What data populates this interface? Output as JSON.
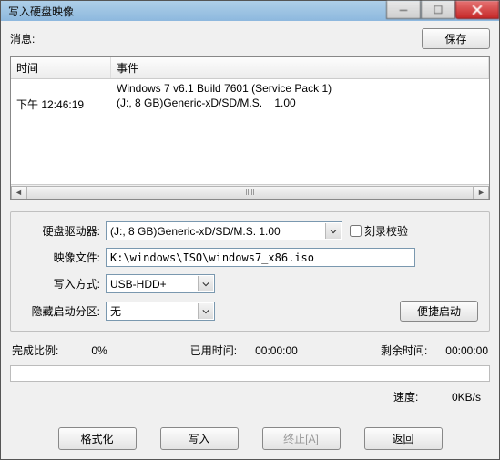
{
  "titlebar": {
    "title": "写入硬盘映像"
  },
  "msg_label": "消息:",
  "save_btn": "保存",
  "log": {
    "col_time": "时间",
    "col_event": "事件",
    "rows": [
      {
        "time": "",
        "event": "Windows 7 v6.1 Build 7601 (Service Pack 1)"
      },
      {
        "time": "下午 12:46:19",
        "event": "(J:, 8 GB)Generic-xD/SD/M.S.    1.00"
      }
    ]
  },
  "form": {
    "drive_label": "硬盘驱动器:",
    "drive_value": "(J:, 8 GB)Generic-xD/SD/M.S.    1.00",
    "verify_label": "刻录校验",
    "image_label": "映像文件:",
    "image_value": "K:\\windows\\ISO\\windows7_x86.iso",
    "write_mode_label": "写入方式:",
    "write_mode_value": "USB-HDD+",
    "hidden_part_label": "隐藏启动分区:",
    "hidden_part_value": "无",
    "convenient_boot_btn": "便捷启动"
  },
  "status": {
    "done_label": "完成比例:",
    "done_value": "0%",
    "elapsed_label": "已用时间:",
    "elapsed_value": "00:00:00",
    "remain_label": "剩余时间:",
    "remain_value": "00:00:00",
    "speed_label": "速度:",
    "speed_value": "0KB/s"
  },
  "buttons": {
    "format": "格式化",
    "write": "写入",
    "abort": "终止[A]",
    "back": "返回"
  }
}
